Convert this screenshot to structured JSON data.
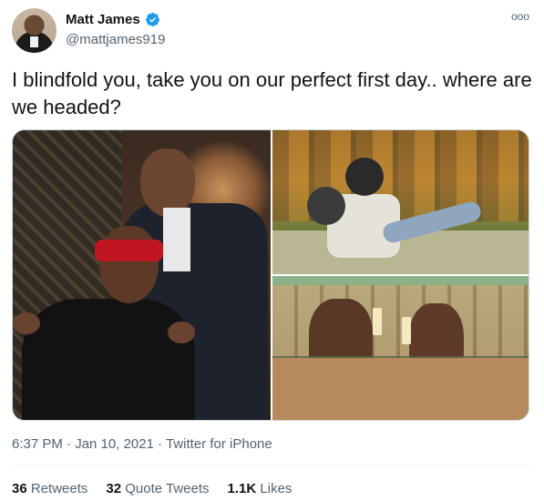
{
  "tweet": {
    "author": {
      "name": "Matt James",
      "handle": "@mattjames919",
      "verified": true
    },
    "more_icon": "ooo",
    "text": "I blindfold you, take you on our perfect first day.. where are we headed?",
    "media": [
      {
        "icon": "photo-blindfold"
      },
      {
        "icon": "photo-motorcycle-helmets"
      },
      {
        "icon": "photo-hot-tub"
      }
    ],
    "timestamp": "6:37 PM · Jan 10, 2021",
    "source": "Twitter for iPhone",
    "stats": {
      "retweets_count": "36",
      "retweets_label": "Retweets",
      "quote_count": "32",
      "quote_label": "Quote Tweets",
      "likes_count": "1.1K",
      "likes_label": "Likes"
    }
  },
  "colors": {
    "text": "#0f1419",
    "secondary": "#536471",
    "verified": "#1d9bf0",
    "border": "#cfd9de"
  }
}
